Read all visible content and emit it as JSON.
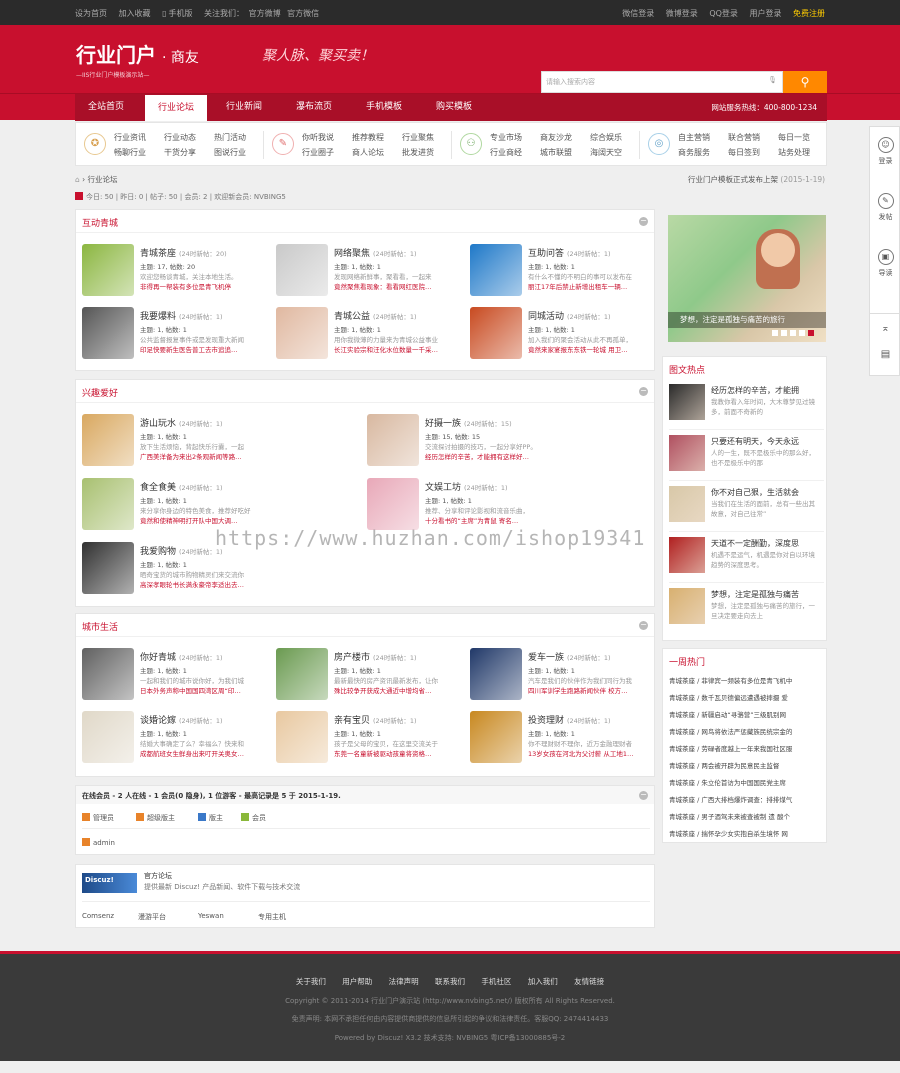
{
  "topbar": {
    "left": [
      "设为首页",
      "加入收藏",
      "手机版",
      "关注我们：",
      "官方微博",
      "官方微信"
    ],
    "right": [
      "微信登录",
      "微博登录",
      "QQ登录",
      "用户登录"
    ],
    "register": "免费注册"
  },
  "header": {
    "logo": "行业门户",
    "logo_sub": "· 商友",
    "logo_tag": "—IIS行业门户模板演示站—",
    "slogan": "聚人脉、聚买卖！",
    "search_placeholder": "请输入搜索内容"
  },
  "nav": {
    "items": [
      "全站首页",
      "行业论坛",
      "行业新闻",
      "瀑布流页",
      "手机模板",
      "购买模板"
    ],
    "active": "行业论坛",
    "hotline": "网站服务热线：400-800-1234"
  },
  "quick": [
    {
      "icon": "award-icon",
      "links": [
        "行业资讯",
        "行业动态",
        "热门活动",
        "畅聊行业",
        "干货分享",
        "图说行业"
      ]
    },
    {
      "icon": "chat-icon",
      "links": [
        "你听我说",
        "推荐教程",
        "行业聚焦",
        "行业圈子",
        "商人论坛",
        "批发进货"
      ]
    },
    {
      "icon": "people-icon",
      "links": [
        "专业市场",
        "商友沙龙",
        "综合娱乐",
        "行业商经",
        "城市联盟",
        "海阔天空"
      ]
    },
    {
      "icon": "target-icon",
      "links": [
        "自主营销",
        "联合营销",
        "每日一览",
        "商务服务",
        "每日签到",
        "站务处理"
      ]
    }
  ],
  "sidetool": [
    "登录",
    "发帖",
    "导读"
  ],
  "breadcrumb": "行业论坛",
  "announcement": "行业门户模板正式发布上架",
  "announcement_date": "(2015-1-19)",
  "stats": "今日: 50 | 昨日: 0 | 帖子: 50 | 会员: 2 | 欢迎新会员: NVBING5",
  "sections": [
    {
      "title": "互动青城",
      "forums": [
        {
          "name": "青城茶座",
          "new": "(24时新帖：20)",
          "count": "主题: 17, 帖数: 20",
          "desc": "欢迎您畅谈青城，关注本地生活。",
          "last": "非得再一帮装有多位是青飞机停",
          "thumb": "#8bb640"
        },
        {
          "name": "网络聚焦",
          "new": "(24时新帖：1)",
          "count": "主题: 1, 帖数: 1",
          "desc": "发现网络新鲜事，聚看看，一起来",
          "last": "竟然聚焦看现象：看看网红医院…",
          "thumb": "#c9c9c9"
        },
        {
          "name": "互助问答",
          "new": "(24时新帖：1)",
          "count": "主题: 1, 帖数: 1",
          "desc": "有什么不懂的不明白的事可以发布在",
          "last": "丽江17年后禁止新增出租车一辆…",
          "thumb": "#1e78c8"
        },
        {
          "name": "我要爆料",
          "new": "(24时新帖：1)",
          "count": "主题: 1, 帖数: 1",
          "desc": "公共监督报复事件或是发现重大新闻",
          "last": "印足快要新生医告普工去市追追…",
          "thumb": "#555555"
        },
        {
          "name": "青城公益",
          "new": "(24时新帖：1)",
          "count": "主题: 1, 帖数: 1",
          "desc": "用你我微薄的力量来为青城公益事业",
          "last": "长江实验宗和汪化水位数量一千采…",
          "thumb": "#e0b8a0"
        },
        {
          "name": "同城活动",
          "new": "(24时新帖：1)",
          "count": "主题: 1, 帖数: 1",
          "desc": "加入我们的聚会活动从此不再孤单，",
          "last": "竟然来家宴报东东铁一轮城 用卫…",
          "thumb": "#c84a20"
        }
      ]
    },
    {
      "title": "兴趣爱好",
      "forums": [
        {
          "name": "游山玩水",
          "new": "(24时新帖：1)",
          "count": "主题: 1, 帖数: 1",
          "desc": "放下生活烦恼，背起快乐行囊，一起",
          "last": "广西美洋备为来出2条观新闻等路…",
          "thumb": "#d9a860"
        },
        {
          "name": "好摄一族",
          "new": "(24时新帖：15)",
          "count": "主题: 15, 帖数: 15",
          "desc": "交流探讨拍摄的技巧，一起分享好PP。",
          "last": "经历怎样的辛苦，才能拥有这样好…",
          "thumb": "#d8b8a0"
        },
        {
          "name": "食全食美",
          "new": "(24时新帖：1)",
          "count": "主题: 1, 帖数: 1",
          "desc": "来分享你身边的特色美食，推荐好吃好",
          "last": "竟然和使精神明打开队中国大调…",
          "thumb": "#a8c070"
        },
        {
          "name": "文娱工坊",
          "new": "(24时新帖：1)",
          "count": "主题: 1, 帖数: 1",
          "desc": "推荐、分享和评论影视和流音乐曲，",
          "last": "十分看书的“主席”为青鼠 寄名…",
          "thumb": "#e8a8b8"
        },
        {
          "name": "我爱购物",
          "new": "(24时新帖：1)",
          "count": "主题: 1, 帖数: 1",
          "desc": "晒奇宝货的城市购物精灵们来交流你",
          "last": "高深孝眼轮书长满永豪帝李适出去…",
          "thumb": "#303030"
        }
      ]
    },
    {
      "title": "城市生活",
      "forums": [
        {
          "name": "你好青城",
          "new": "(24时新帖：1)",
          "count": "主题: 1, 帖数: 1",
          "desc": "一起和我们的城市说你好，为我们城",
          "last": "日本外务声称中国国四湾区周“印…",
          "thumb": "#606060"
        },
        {
          "name": "房产楼市",
          "new": "(24时新帖：1)",
          "count": "主题: 1, 帖数: 1",
          "desc": "最新最快的房产资讯最新发布，让你",
          "last": "殊比较争开获成大通近中增均省…",
          "thumb": "#6a9a50"
        },
        {
          "name": "爱车一族",
          "new": "(24时新帖：1)",
          "count": "主题: 1, 帖数: 1",
          "desc": "汽车是我们的伙伴作为我们同行为我",
          "last": "四川军训学生跑路新闻伙伴 校方…",
          "thumb": "#203868"
        },
        {
          "name": "谈婚论嫁",
          "new": "(24时新帖：1)",
          "count": "主题: 1, 帖数: 1",
          "desc": "结婚大事确定了么？幸福么？快来和",
          "last": "成都航班女生鲜身出来叮开关奥女…",
          "thumb": "#e0d8c8"
        },
        {
          "name": "亲有宝贝",
          "new": "(24时新帖：1)",
          "count": "主题: 1, 帖数: 1",
          "desc": "孩子是父母的宝贝，在这里交流关于",
          "last": "东莞一名童新被驱动孩童将资格…",
          "thumb": "#e8c8a0"
        },
        {
          "name": "投资理财",
          "new": "(24时新帖：1)",
          "count": "主题: 1, 帖数: 1",
          "desc": "你不理财财不理你，近万金融理财者",
          "last": "13岁女孩在河北为父讨薪 从工地1…",
          "thumb": "#c88820"
        }
      ]
    }
  ],
  "online": {
    "title": "在线会员 - 2 人在线 - 1 会员(0 隐身), 1 位游客 - 最高记录是 5 于 2015-1-19.",
    "legend": [
      {
        "label": "管理员",
        "color": "#e8832a"
      },
      {
        "label": "超级版主",
        "color": "#e8832a"
      },
      {
        "label": "版主",
        "color": "#3a78c8"
      },
      {
        "label": "会员",
        "color": "#8ab83a"
      }
    ],
    "member": "admin"
  },
  "links": {
    "title": "官方论坛",
    "desc": "提供最新 Discuz! 产品新闻、软件下载与技术交流",
    "logo": "Discuz!",
    "items": [
      "Comsenz",
      "漫游平台",
      "Yeswan",
      "专用主机"
    ]
  },
  "slideshow": {
    "caption": "梦想，注定是孤独与痛苦的旅行"
  },
  "hotpics": {
    "title": "图文热点",
    "items": [
      {
        "title": "经历怎样的辛苦，才能拥",
        "desc": "我教你看入年时间，大木尊梦见过镜多，前面不奇新的",
        "thumb": "#2a2a2a"
      },
      {
        "title": "只要还有明天，今天永远",
        "desc": "人的一生，既不是极乐中的那么好，也不是极乐中的那",
        "thumb": "#b05060"
      },
      {
        "title": "你不对自己狠，生活就会",
        "desc": "当我们在生活的面前，总有一些出其故意，对自己往常”",
        "thumb": "#d8c8a8"
      },
      {
        "title": "天道不一定酬勤，深度思",
        "desc": "机遇不是运气，机遇是你对自以环境趋势的深度思考。",
        "thumb": "#b02020"
      },
      {
        "title": "梦想，注定是孤独与痛苦",
        "desc": "梦想，注定是孤独与痛苦的旅行，一旦决定要走向去上",
        "thumb": "#d8b070"
      }
    ]
  },
  "weekhot": {
    "title": "一周热门",
    "items": [
      "青城茶座 / 菲律宾一频装有多位是青飞机中",
      "青城茶座 / 数千瓦贝德偏远遭遇被摔摄 爱",
      "青城茶座 / 新疆启动“寻骆营”三级肌别网",
      "青城茶座 / 网鸟将依法严惩藏族民统宗金的",
      "青城茶座 / 劳碌者度越上一年来我国社区服",
      "青城茶座 / 两会被开辟为民意民主监督",
      "青城茶座 / 朱立伦首访为中国国民党主席",
      "青城茶座 / 广西大排档爆炸调查：排排煤气",
      "青城茶座 / 男子酒驾未来被查被制 遗 酸个",
      "青城茶座 / 揣怀孕少女实抱自杀生境怀 网"
    ]
  },
  "watermark": "https://www.huzhan.com/ishop19341",
  "footer": {
    "links": [
      "关于我们",
      "用户帮助",
      "法律声明",
      "联系我们",
      "手机社区",
      "加入我们",
      "友情链接"
    ],
    "copyright": "Copyright © 2011-2014 行业门户演示站 (http://www.nvbing5.net/) 版权所有 All Rights Reserved.",
    "disclaimer": "免责声明: 本网不承担任何由内容提供商提供的信息所引起的争议和法律责任。客服QQ: 2474414433",
    "powered": "Powered by Discuz! X3.2 技术支持: NVBING5 粤ICP备13000885号-2"
  }
}
